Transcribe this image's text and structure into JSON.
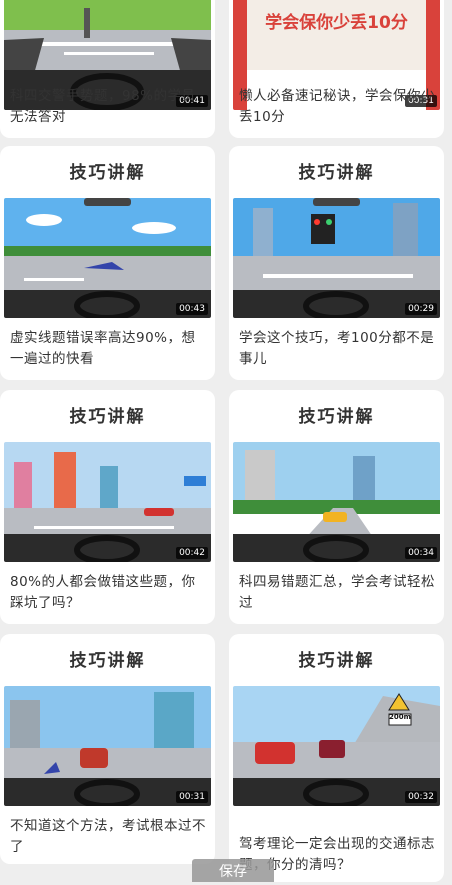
{
  "cards": [
    {
      "title": "",
      "duration": "00:41",
      "caption": "科四交警手势题，98%的学员无法答对"
    },
    {
      "title": "",
      "banner": "学会保你少丢10分",
      "duration": "00:31",
      "caption": "懒人必备速记秘诀，学会保你少丢10分"
    },
    {
      "title": "技巧讲解",
      "duration": "00:43",
      "caption": "虚实线题错误率高达90%，想一遍过的快看"
    },
    {
      "title": "技巧讲解",
      "duration": "00:29",
      "caption": "学会这个技巧，考100分都不是事儿"
    },
    {
      "title": "技巧讲解",
      "duration": "00:42",
      "caption": "80%的人都会做错这些题，你踩坑了吗？"
    },
    {
      "title": "技巧讲解",
      "duration": "00:34",
      "caption": "科四易错题汇总，学会考试轻松过"
    },
    {
      "title": "技巧讲解",
      "duration": "00:31",
      "caption": "不知道这个方法，考试根本过不了"
    },
    {
      "title": "技巧讲解",
      "sign_label": "200m",
      "duration": "00:32",
      "caption": "驾考理论一定会出现的交通标志题，你分的清吗？"
    }
  ],
  "save_label": "保存",
  "colors": {
    "sky": "#4fa8e8",
    "road": "#b9bcc2",
    "dashboard": "#2b2b2b",
    "banner": "#d9423b"
  }
}
